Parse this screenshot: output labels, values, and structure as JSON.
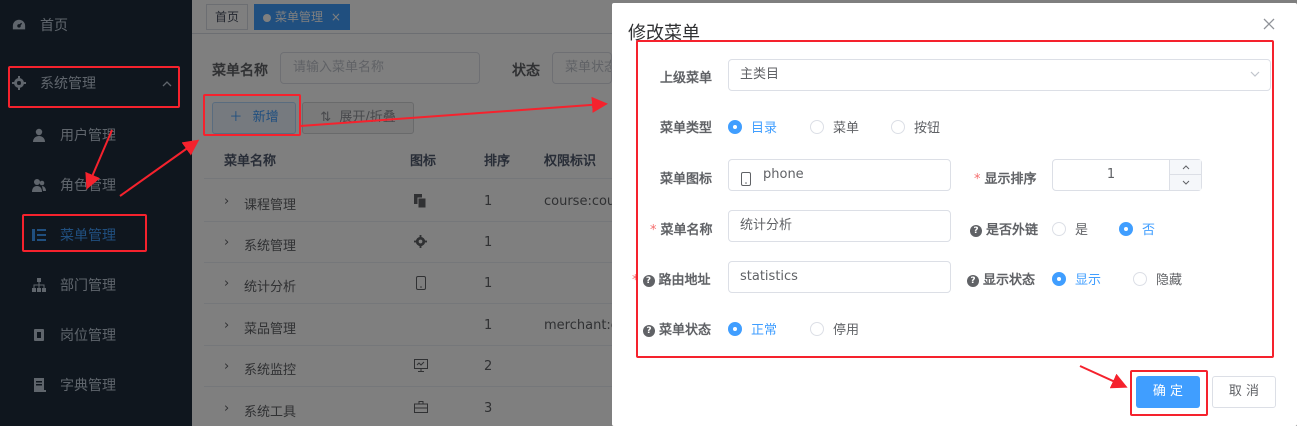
{
  "sidebar": {
    "items": [
      {
        "label": "首页",
        "icon": "dashboard-icon"
      },
      {
        "label": "系统管理",
        "icon": "gear-icon"
      },
      {
        "label": "用户管理",
        "icon": "user-icon"
      },
      {
        "label": "角色管理",
        "icon": "users-icon"
      },
      {
        "label": "菜单管理",
        "icon": "tree-table-icon"
      },
      {
        "label": "部门管理",
        "icon": "org-tree-icon"
      },
      {
        "label": "岗位管理",
        "icon": "post-icon"
      },
      {
        "label": "字典管理",
        "icon": "dict-icon"
      }
    ]
  },
  "tabs": {
    "home": "首页",
    "current": "菜单管理"
  },
  "search": {
    "name_label": "菜单名称",
    "name_placeholder": "请输入菜单名称",
    "status_label": "状态",
    "status_placeholder": "菜单状态"
  },
  "toolbar": {
    "add": "新增",
    "expand": "展开/折叠"
  },
  "table": {
    "headers": [
      "菜单名称",
      "图标",
      "排序",
      "权限标识"
    ],
    "rows": [
      {
        "name": "课程管理",
        "icon": "copy-icon",
        "sort": "1",
        "perm": "course:cou"
      },
      {
        "name": "系统管理",
        "icon": "gear-icon",
        "sort": "1",
        "perm": ""
      },
      {
        "name": "统计分析",
        "icon": "phone-icon",
        "sort": "1",
        "perm": ""
      },
      {
        "name": "菜品管理",
        "icon": "",
        "sort": "1",
        "perm": "merchant:c"
      },
      {
        "name": "系统监控",
        "icon": "monitor-icon",
        "sort": "2",
        "perm": ""
      },
      {
        "name": "系统工具",
        "icon": "toolbox-icon",
        "sort": "3",
        "perm": ""
      }
    ]
  },
  "dialog": {
    "title": "修改菜单",
    "parent_label": "上级菜单",
    "parent_value": "主类目",
    "type_label": "菜单类型",
    "type_options": [
      "目录",
      "菜单",
      "按钮"
    ],
    "type_selected": "目录",
    "icon_label": "菜单图标",
    "icon_value": "phone",
    "sort_label": "显示排序",
    "sort_value": "1",
    "name_label": "菜单名称",
    "name_value": "统计分析",
    "external_label": "是否外链",
    "external_options": [
      "是",
      "否"
    ],
    "external_selected": "否",
    "path_label": "路由地址",
    "path_value": "statistics",
    "visible_label": "显示状态",
    "visible_options": [
      "显示",
      "隐藏"
    ],
    "visible_selected": "显示",
    "status_label": "菜单状态",
    "status_options": [
      "正常",
      "停用"
    ],
    "status_selected": "正常",
    "ok": "确 定",
    "cancel": "取 消"
  },
  "colors": {
    "accent": "#409eff",
    "sidebar": "#1f2d3d",
    "annotation": "#f5222d"
  }
}
